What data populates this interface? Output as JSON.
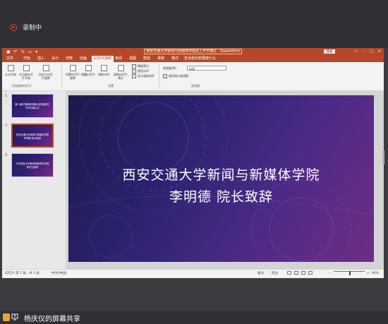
{
  "recording": {
    "label": "录制中"
  },
  "ppt": {
    "doc_title": "西安交通大学新闻与新媒体学院线上开学典礼 - PowerPoint",
    "signin": "登录",
    "tabs": [
      "文件",
      "开始",
      "插入",
      "设计",
      "切换",
      "动画",
      "幻灯片放映",
      "审阅",
      "视图",
      "帮助",
      "录制",
      "格式",
      "告诉我你想要做什么"
    ],
    "active_tab": "幻灯片放映",
    "ribbon": {
      "start_group": {
        "buttons": [
          "从头开始",
          "从当前幻灯片开始",
          "自定义幻灯片放映"
        ],
        "label": "开始放映幻灯片"
      },
      "setup_group": {
        "buttons": [
          "设置幻灯片放映",
          "隐藏幻灯片",
          "排练计时",
          "录制幻灯片演示"
        ],
        "checks": [
          "播放旁白",
          "使用计时",
          "显示媒体控件"
        ],
        "label": "设置"
      },
      "monitor_group": {
        "monitor_label": "监视器(M):",
        "monitor_value": "自动",
        "presenter_view": "使用演示者视图",
        "label": "监视器"
      }
    },
    "slides": [
      {
        "num": "1",
        "text": "第八届中国新闻传播大会暨新闻工作坊开幕仪式"
      },
      {
        "num": "2",
        "text": "西安交通大学新闻与新媒体学院 李明德 院长致辞"
      },
      {
        "num": "3",
        "text": "中央党校大学新闻传播学院 院党委书记致辞"
      }
    ],
    "current_slide": {
      "line1": "西安交通大学新闻与新媒体学院",
      "line2": "李明德 院长致辞"
    },
    "status": {
      "slide_info": "幻灯片 第 2 张，共 3 张",
      "language": "中文(中国)",
      "notes": "备注",
      "comments": "批注",
      "zoom": "90%"
    }
  },
  "share": {
    "label": "杨庆仪的屏幕共享"
  }
}
